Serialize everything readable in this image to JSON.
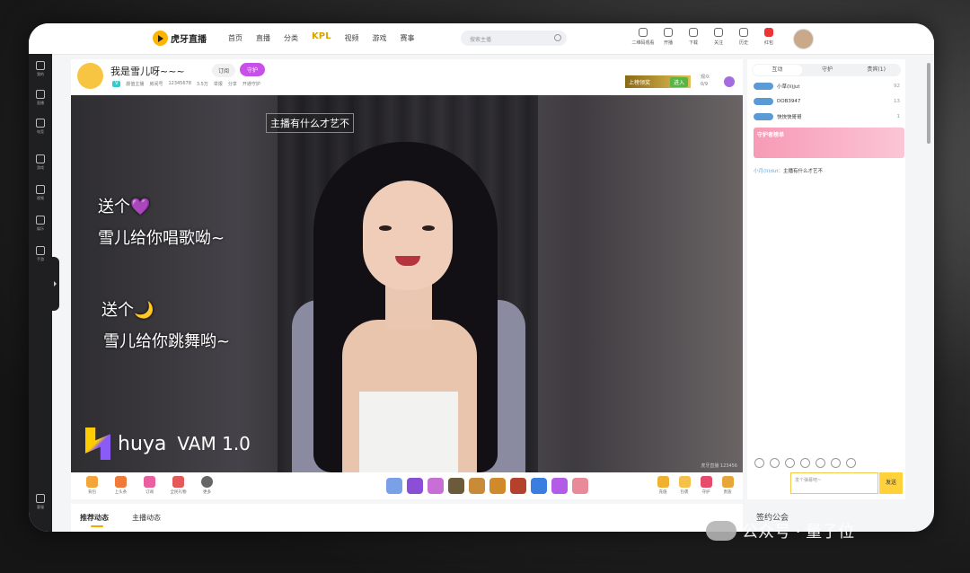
{
  "header": {
    "logo": "虎牙直播",
    "nav": [
      "首页",
      "直播",
      "分类",
      "KPL",
      "视频",
      "游戏",
      "赛事"
    ],
    "search_placeholder": "搜索主播",
    "tools": [
      "二维码观看",
      "开播",
      "下载",
      "关注",
      "历史",
      "红包"
    ]
  },
  "sidebar": {
    "items": [
      "我的",
      "直播",
      "电竞",
      "游戏",
      "视频",
      "娱乐",
      "手游"
    ],
    "bottom": "客服"
  },
  "room": {
    "title": "我是雪儿呀~~~",
    "follow_label": "订阅",
    "guard_label": "守护",
    "meta": {
      "tag": "V",
      "category": "颜值主播",
      "id": "房间号",
      "room_no": "12345678",
      "fans": "3.5万",
      "report": "举报",
      "share": "分享",
      "guard_count": "开通守护"
    },
    "promo": "上榜领奖",
    "promo_btn": "进入",
    "viewers": [
      "观众",
      "0/9"
    ]
  },
  "video": {
    "question": "主播有什么才艺不",
    "line1": "送个",
    "line1_icon": "💜",
    "line2": "雪儿给你唱歌呦~",
    "line3": "送个",
    "line3_icon": "🌙",
    "line4": "雪儿给你跳舞哟~",
    "brand": "huya",
    "product": "VAM 1.0",
    "id": "虎牙直播 123456"
  },
  "giftbar": {
    "left": [
      "背包",
      "上头条",
      "订阅",
      "全民礼物",
      "更多"
    ],
    "right": [
      "充值",
      "包裹",
      "守护",
      "贵族"
    ]
  },
  "bottom_tabs": [
    "推荐动态",
    "主播动态"
  ],
  "chat": {
    "tabs": [
      "互动",
      "守护",
      "贵宾(1)"
    ],
    "rows": [
      {
        "name": "小草(li)jut",
        "num": "92"
      },
      {
        "name": "DOB3947",
        "num": "13"
      },
      {
        "name": "快快快哥哥",
        "num": "1"
      }
    ],
    "guard_card": "守护者榜单",
    "message": {
      "nick": "小月(li)dut：",
      "text": "主播有什么才艺不"
    },
    "input_placeholder": "发个弹幕吧~",
    "send": "发送"
  },
  "signed": "签约公会",
  "watermark": "公众号 · 量子位"
}
